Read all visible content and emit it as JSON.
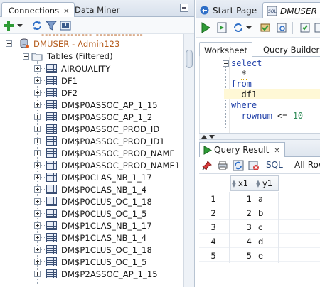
{
  "left_panel": {
    "tabs": [
      {
        "label": "Connections",
        "active": true,
        "closable": true
      },
      {
        "label": "Data Miner",
        "active": false,
        "closable": false
      }
    ],
    "tree": {
      "connection": {
        "label": "DMUSER - Admin123",
        "color": "#b45a1a"
      },
      "folder": {
        "label": "Tables (Filtered)"
      },
      "tables": [
        "AIRQUALITY",
        "DF1",
        "DF2",
        "DM$P0ASSOC_AP_1_15",
        "DM$P0ASSOC_AP_1_2",
        "DM$P0ASSOC_PROD_ID",
        "DM$P0ASSOC_PROD_ID1",
        "DM$P0ASSOC_PROD_NAME",
        "DM$P0ASSOC_PROD_NAME1",
        "DM$P0CLAS_NB_1_17",
        "DM$P0CLAS_NB_1_4",
        "DM$P0CLUS_OC_1_18",
        "DM$P0CLUS_OC_1_5",
        "DM$P1CLAS_NB_1_17",
        "DM$P1CLAS_NB_1_4",
        "DM$P1CLUS_OC_1_18",
        "DM$P1CLUS_OC_1_5",
        "DM$P2ASSOC_AP_1_15"
      ]
    }
  },
  "right_panel": {
    "tabs": [
      {
        "label": "Start Page",
        "active": false
      },
      {
        "label": "DMUSER",
        "active": true
      }
    ],
    "sub_tabs": [
      {
        "label": "Worksheet",
        "active": true
      },
      {
        "label": "Query Builder",
        "active": false
      }
    ],
    "editor": {
      "lines": [
        {
          "kind": "keyword",
          "text": "select"
        },
        {
          "kind": "plain",
          "text": "  *"
        },
        {
          "kind": "keyword",
          "text": "from"
        },
        {
          "kind": "plain",
          "text": "  df1"
        },
        {
          "kind": "keyword",
          "text": "where"
        },
        {
          "kind": "mixed",
          "text_kw": "  rownum",
          "text_op": " <= ",
          "text_num": "10"
        }
      ]
    },
    "query_result": {
      "tab_label": "Query Result",
      "toolbar": {
        "sql_label": "SQL",
        "fetch_label": "All Rows"
      },
      "columns": [
        "x1",
        "y1"
      ],
      "rows": [
        {
          "n": "1",
          "x1": "1",
          "y1": "a"
        },
        {
          "n": "2",
          "x1": "2",
          "y1": "b"
        },
        {
          "n": "3",
          "x1": "3",
          "y1": "c"
        },
        {
          "n": "4",
          "x1": "4",
          "y1": "d"
        },
        {
          "n": "5",
          "x1": "5",
          "y1": "e"
        }
      ]
    }
  },
  "colors": {
    "accent_green": "#2e9b36",
    "tree_connection_text": "#b45a1a",
    "keyword_blue": "#1f3fa8",
    "number_green": "#2e8b57"
  }
}
